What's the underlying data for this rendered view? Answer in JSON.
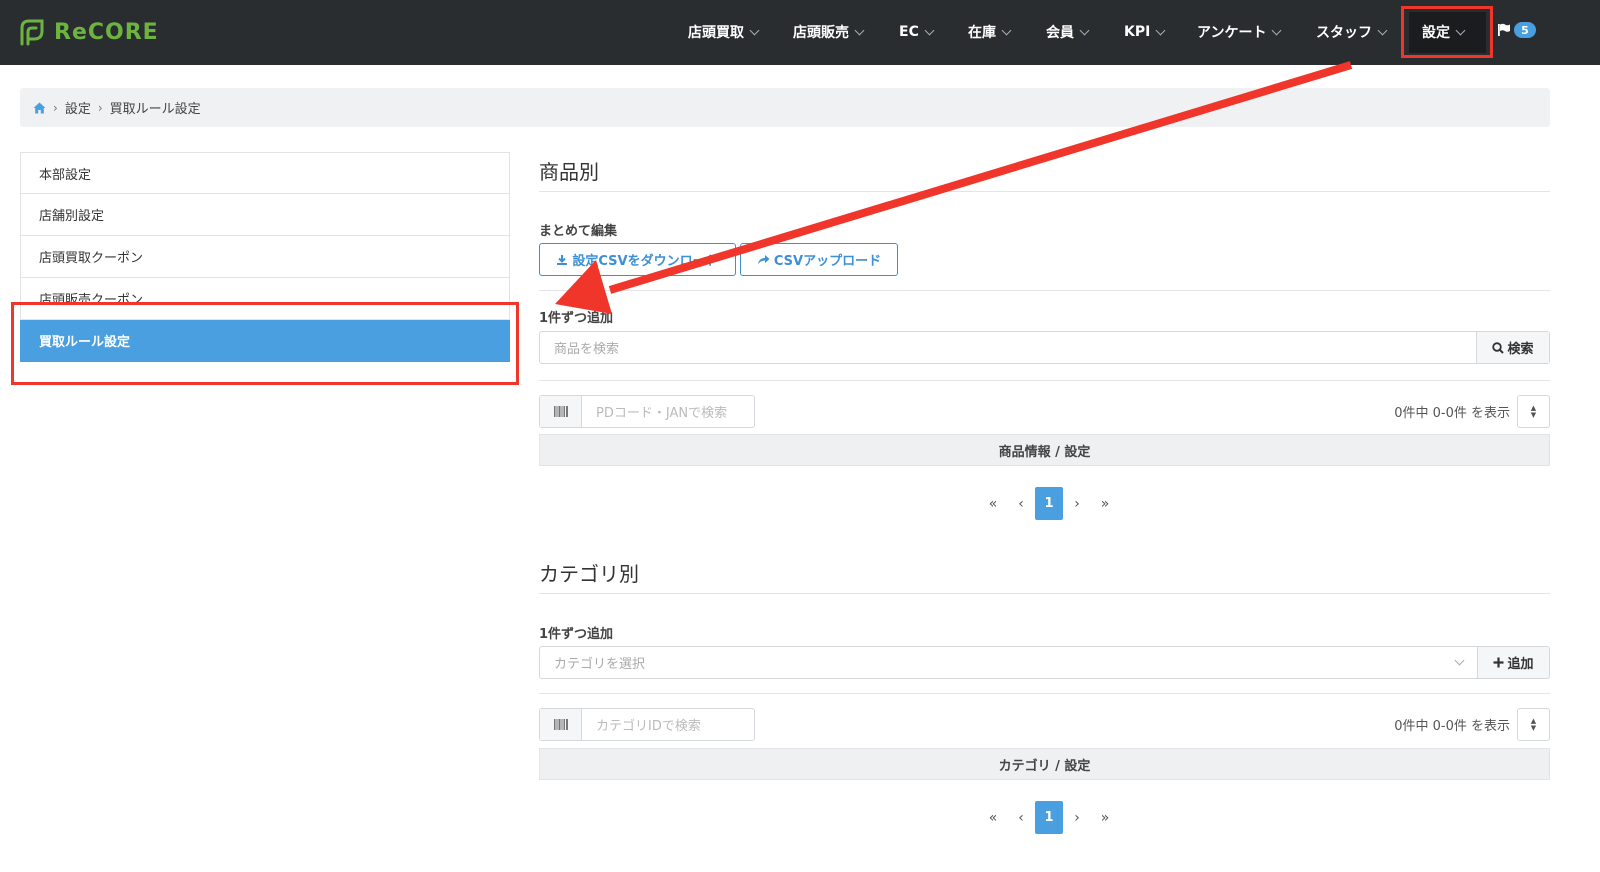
{
  "app": {
    "logo_text": "ReCORE"
  },
  "nav": {
    "items": [
      {
        "label": "店頭買取"
      },
      {
        "label": "店頭販売"
      },
      {
        "label": "EC"
      },
      {
        "label": "在庫"
      },
      {
        "label": "会員"
      },
      {
        "label": "KPI"
      },
      {
        "label": "アンケート"
      },
      {
        "label": "スタッフ"
      },
      {
        "label": "設定"
      }
    ],
    "notification_count": "5"
  },
  "breadcrumb": {
    "level1": "設定",
    "level2": "買取ルール設定"
  },
  "sidebar": {
    "items": [
      {
        "label": "本部設定"
      },
      {
        "label": "店舗別設定"
      },
      {
        "label": "店頭買取クーポン"
      },
      {
        "label": "店頭販売クーポン"
      },
      {
        "label": "買取ルール設定"
      }
    ]
  },
  "product_section": {
    "title": "商品別",
    "bulk_label": "まとめて編集",
    "download_label": "設定CSVをダウンロード",
    "upload_label": "CSVアップロード",
    "single_add_label": "1件ずつ追加",
    "search_placeholder": "商品を検索",
    "search_button": "検索",
    "code_placeholder": "PDコード・JANで検索",
    "count_text": "0件中 0-0件 を表示",
    "table_header": "商品情報 / 設定",
    "pager": {
      "first": "«",
      "prev": "‹",
      "current": "1",
      "next": "›",
      "last": "»"
    }
  },
  "category_section": {
    "title": "カテゴリ別",
    "single_add_label": "1件ずつ追加",
    "select_placeholder": "カテゴリを選択",
    "add_button": "追加",
    "id_placeholder": "カテゴリIDで検索",
    "count_text": "0件中 0-0件 を表示",
    "table_header": "カテゴリ / 設定",
    "pager": {
      "first": "«",
      "prev": "‹",
      "current": "1",
      "next": "›",
      "last": "»"
    }
  },
  "colors": {
    "accent": "#4a9fe0",
    "annotation": "#f0352a",
    "navbar": "#2a2d30",
    "brand": "#6cb33f"
  }
}
